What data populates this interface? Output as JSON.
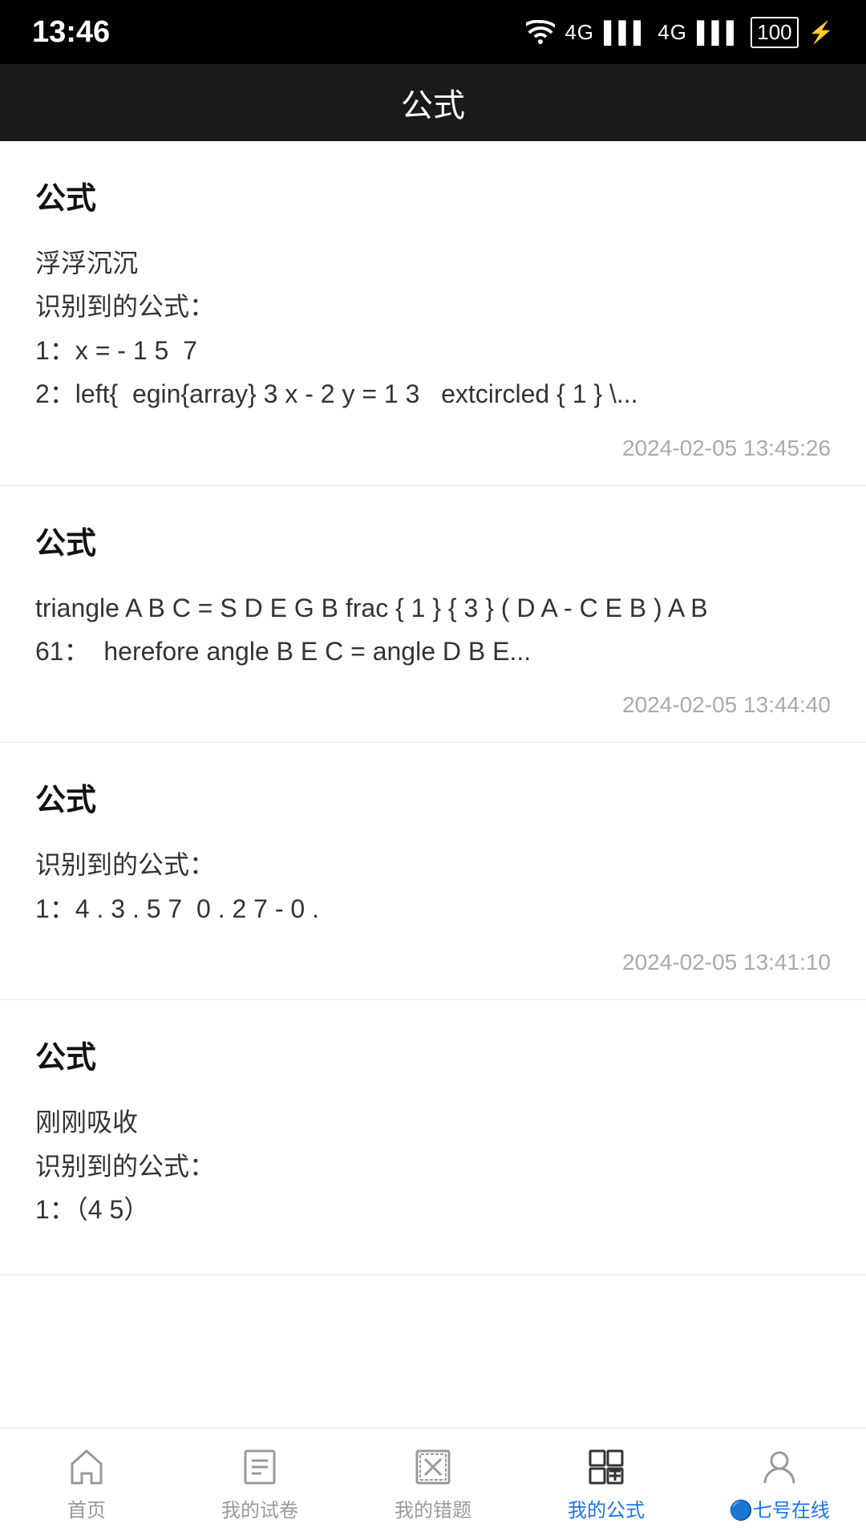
{
  "statusBar": {
    "time": "13:46",
    "icons": "📶 4G 📶 4G 🔋"
  },
  "navBar": {
    "title": "公式"
  },
  "cards": [
    {
      "id": "card-1",
      "title": "公式",
      "body": "浮浮沉沉\n识别到的公式：\n1：x = - 1 5  7\n2：left{  egin{array} 3 x - 2 y = 1 3   extcircled { 1 } \\...",
      "time": "2024-02-05 13:45:26"
    },
    {
      "id": "card-2",
      "title": "公式",
      "body": "triangle A B C = S D E G B frac { 1 } { 3 } ( D A - C E B ) A B\n61：  herefore angle B E C = angle D B E...",
      "time": "2024-02-05 13:44:40"
    },
    {
      "id": "card-3",
      "title": "公式",
      "body": "识别到的公式：\n1：4 . 3 . 5 7  0 . 2 7 - 0 .",
      "time": "2024-02-05 13:41:10"
    },
    {
      "id": "card-4",
      "title": "公式",
      "body": "刚刚吸收\n识别到的公式：\n1：（4 5）",
      "time": ""
    }
  ],
  "bottomNav": {
    "items": [
      {
        "id": "home",
        "label": "首页",
        "active": false
      },
      {
        "id": "papers",
        "label": "我的试卷",
        "active": false
      },
      {
        "id": "errors",
        "label": "我的错题",
        "active": false
      },
      {
        "id": "formulas",
        "label": "我的公式",
        "active": true
      },
      {
        "id": "online",
        "label": "🔵七号在线",
        "active": false,
        "special": true
      }
    ]
  }
}
